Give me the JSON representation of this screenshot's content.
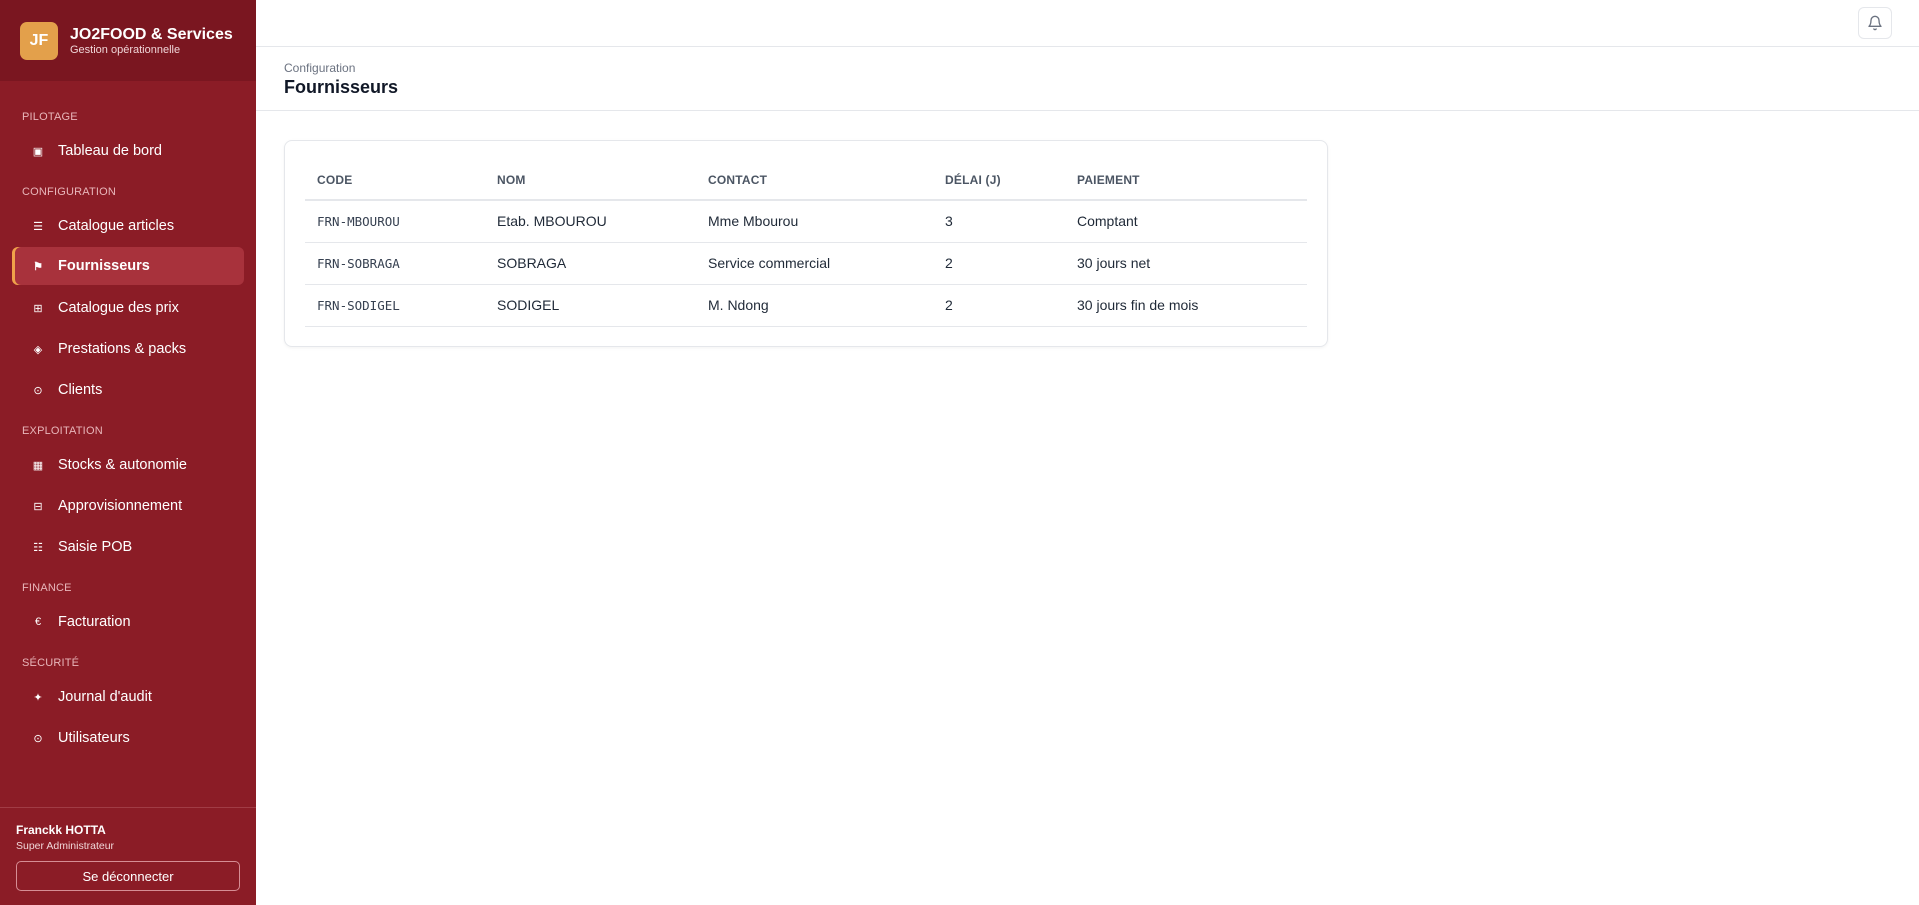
{
  "brand": {
    "logo": "JF",
    "title": "JO2FOOD & Services",
    "subtitle": "Gestion opérationnelle"
  },
  "sidebar": {
    "sections": [
      {
        "label": "PILOTAGE"
      },
      {
        "label": "CONFIGURATION"
      },
      {
        "label": "EXPLOITATION"
      },
      {
        "label": "FINANCE"
      },
      {
        "label": "SÉCURITÉ"
      }
    ],
    "items": [
      {
        "label": "Tableau de bord",
        "icon": "dashboard-icon",
        "glyph": "▣"
      },
      {
        "label": "Catalogue articles",
        "icon": "list-icon",
        "glyph": "☰"
      },
      {
        "label": "Fournisseurs",
        "icon": "flag-icon",
        "glyph": "⚑"
      },
      {
        "label": "Catalogue des prix",
        "icon": "grid-icon",
        "glyph": "⊞"
      },
      {
        "label": "Prestations & packs",
        "icon": "diamond-icon",
        "glyph": "◈"
      },
      {
        "label": "Clients",
        "icon": "circle-icon",
        "glyph": "⊙"
      },
      {
        "label": "Stocks & autonomie",
        "icon": "stock-icon",
        "glyph": "▦"
      },
      {
        "label": "Approvisionnement",
        "icon": "box-icon",
        "glyph": "⊟"
      },
      {
        "label": "Saisie POB",
        "icon": "checklist-icon",
        "glyph": "☷"
      },
      {
        "label": "Facturation",
        "icon": "euro-icon",
        "glyph": "€"
      },
      {
        "label": "Journal d'audit",
        "icon": "spark-icon",
        "glyph": "✦"
      },
      {
        "label": "Utilisateurs",
        "icon": "user-circle-icon",
        "glyph": "⊙"
      }
    ]
  },
  "user": {
    "name": "Franckk HOTTA",
    "role": "Super Administrateur",
    "logout_label": "Se déconnecter"
  },
  "header": {
    "breadcrumb": "Configuration",
    "title": "Fournisseurs"
  },
  "table": {
    "columns": [
      "CODE",
      "NOM",
      "CONTACT",
      "DÉLAI (J)",
      "PAIEMENT"
    ],
    "rows": [
      [
        "FRN-MBOUROU",
        "Etab. MBOUROU",
        "Mme Mbourou",
        "3",
        "Comptant"
      ],
      [
        "FRN-SOBRAGA",
        "SOBRAGA",
        "Service commercial",
        "2",
        "30 jours net"
      ],
      [
        "FRN-SODIGEL",
        "SODIGEL",
        "M. Ndong",
        "2",
        "30 jours fin de mois"
      ]
    ]
  },
  "colors": {
    "sidebar": "#8b1c26",
    "brand_bar": "#7a1620",
    "accent": "#e3a04b",
    "active_item": "#a8323c"
  }
}
